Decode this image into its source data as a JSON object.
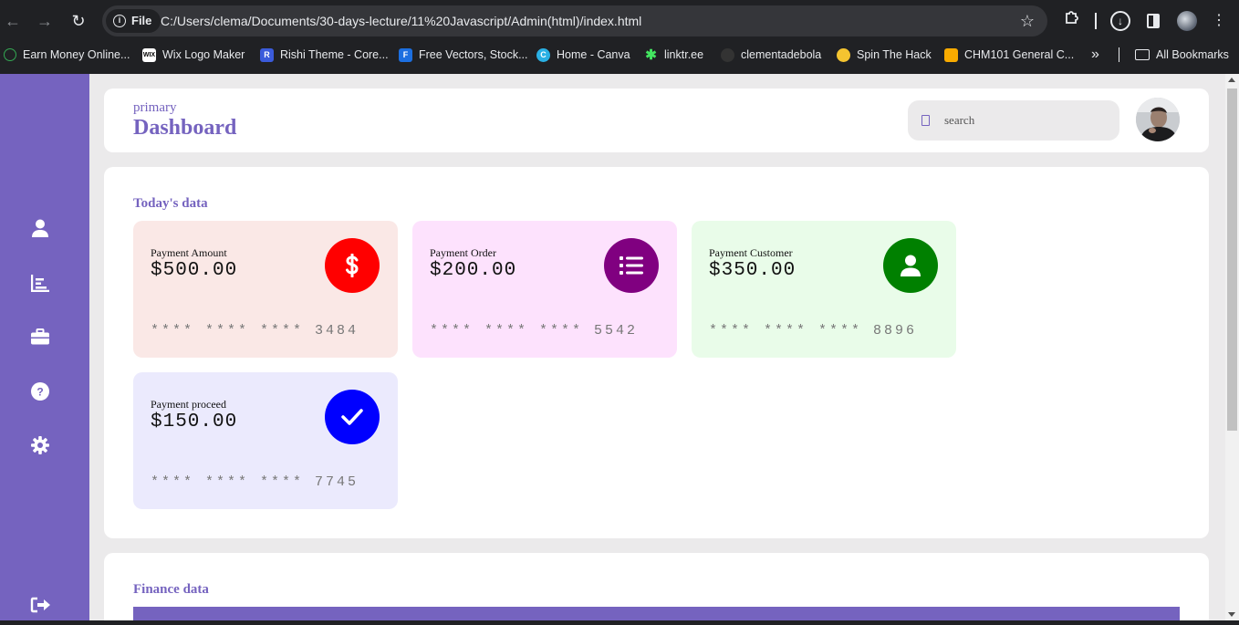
{
  "browser": {
    "site_chip": "File",
    "url": "C:/Users/clema/Documents/30-days-lecture/11%20Javascript/Admin(html)/index.html",
    "bookmarks": [
      {
        "label": "Earn Money Online...",
        "icon": "earn-money-icon",
        "color": "#34a853"
      },
      {
        "label": "Wix Logo Maker",
        "icon": "wix-icon",
        "color": "#ffffff"
      },
      {
        "label": "Rishi Theme - Core...",
        "icon": "rishi-icon",
        "color": "#3b5bdb"
      },
      {
        "label": "Free Vectors, Stock...",
        "icon": "freepik-icon",
        "color": "#1c6fe0"
      },
      {
        "label": "Home - Canva",
        "icon": "canva-icon",
        "color": "#2ab0e4"
      },
      {
        "label": "linktr.ee",
        "icon": "linktree-icon",
        "color": "#43e660"
      },
      {
        "label": "clementadebola",
        "icon": "github-icon",
        "color": "#333333"
      },
      {
        "label": "Spin The Hack",
        "icon": "spin-icon",
        "color": "#f4c430"
      },
      {
        "label": "CHM101 General C...",
        "icon": "classroom-icon",
        "color": "#f9ab00"
      }
    ],
    "all_bookmarks": "All Bookmarks"
  },
  "sidebar": {
    "color": "#7563bf",
    "items": [
      {
        "icon": "user-icon"
      },
      {
        "icon": "chart-icon"
      },
      {
        "icon": "briefcase-icon"
      },
      {
        "icon": "help-icon"
      },
      {
        "icon": "settings-icon"
      },
      {
        "icon": "logout-icon"
      }
    ]
  },
  "header": {
    "subtitle": "primary",
    "title": "Dashboard",
    "search_placeholder": "search"
  },
  "today": {
    "title": "Today's data",
    "cards": [
      {
        "label": "Payment Amount",
        "amount": "$500.00",
        "mask": "**** **** **** 3484",
        "bg": "#fae8e6",
        "icon_bg": "#ff0000",
        "icon": "dollar-icon"
      },
      {
        "label": "Payment Order",
        "amount": "$200.00",
        "mask": "**** **** **** 5542",
        "bg": "#fde2fd",
        "icon_bg": "#800080",
        "icon": "list-icon"
      },
      {
        "label": "Payment Customer",
        "amount": "$350.00",
        "mask": "**** **** **** 8896",
        "bg": "#e9fce9",
        "icon_bg": "#008000",
        "icon": "customer-icon"
      },
      {
        "label": "Payment proceed",
        "amount": "$150.00",
        "mask": "**** **** **** 7745",
        "bg": "#ebeafd",
        "icon_bg": "#0000ff",
        "icon": "check-icon"
      }
    ]
  },
  "finance": {
    "title": "Finance data"
  }
}
